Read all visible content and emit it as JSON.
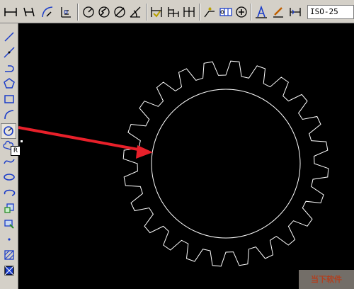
{
  "toolbar": {
    "dimension_style_value": "ISO-25",
    "icons": [
      "linear-dimension-icon",
      "aligned-dimension-icon",
      "arc-length-icon",
      "ordinate-dimension-icon",
      "radius-dimension-icon",
      "jogged-dimension-icon",
      "diameter-dimension-icon",
      "angular-dimension-icon",
      "quick-dimension-icon",
      "baseline-dimension-icon",
      "continue-dimension-icon",
      "quick-leader-icon",
      "tolerance-icon",
      "center-mark-icon",
      "dimension-edit-icon",
      "dimension-text-edit-icon",
      "dimension-update-icon"
    ]
  },
  "sidebar": {
    "tools": [
      "line-icon",
      "construction-line-icon",
      "polyline-icon",
      "polygon-icon",
      "rectangle-icon",
      "arc-icon",
      "circle-icon",
      "revision-cloud-icon",
      "spline-icon",
      "ellipse-icon",
      "ellipse-arc-icon",
      "insert-block-icon",
      "make-block-icon",
      "point-icon",
      "hatch-icon",
      "gradient-icon"
    ],
    "active_tool": "circle-icon",
    "tooltip_text": "R"
  },
  "drawing": {
    "teeth_count": 24,
    "stroke_color": "#ffffff",
    "arrow_color": "#e8202a",
    "background_color": "#000000"
  },
  "watermark": {
    "text": "当下软件"
  }
}
